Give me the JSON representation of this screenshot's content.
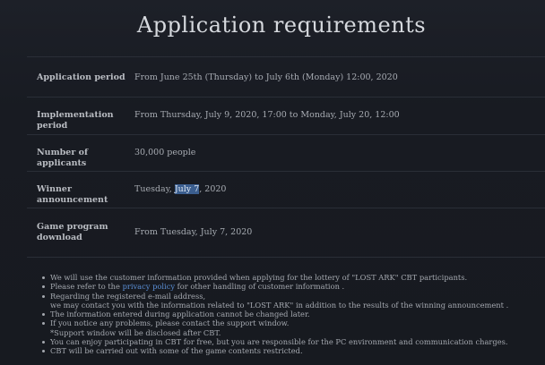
{
  "title": "Application requirements",
  "rows": [
    {
      "label": "Application period",
      "value": "From June 25th (Thursday) to July 6th (Monday) 12:00, 2020"
    },
    {
      "label": "Implementation period",
      "value": "From Thursday, July 9, 2020, 17:00 to Monday, July 20, 12:00"
    },
    {
      "label": "Number of applicants",
      "value": "30,000 people"
    },
    {
      "label": "Winner announcement",
      "value_pre": "Tuesday, ",
      "value_highlight": "July 7",
      "value_post": ", 2020"
    },
    {
      "label_line1": "Game program",
      "label_line2": "download",
      "value": "From Tuesday, July 7, 2020"
    }
  ],
  "notes": {
    "n1": "We will use the customer information provided when applying for the lottery of \"LOST ARK\" CBT participants.",
    "n2_pre": "Please refer to the ",
    "n2_link": "privacy policy",
    "n2_post": " for other handling of customer information .",
    "n3": "Regarding the registered e-mail address,",
    "n3b": "we may contact you with the information related to \"LOST ARK\" in addition to the results of the winning announcement .",
    "n4": "The information entered during application cannot be changed later.",
    "n5": "If you notice any problems, please contact the support window.",
    "n5b": "*Support window will be disclosed after CBT.",
    "n6": "You can enjoy participating in CBT for free, but you are responsible for the PC environment and communication charges.",
    "n7": "CBT will be carried out with some of the game contents restricted."
  }
}
